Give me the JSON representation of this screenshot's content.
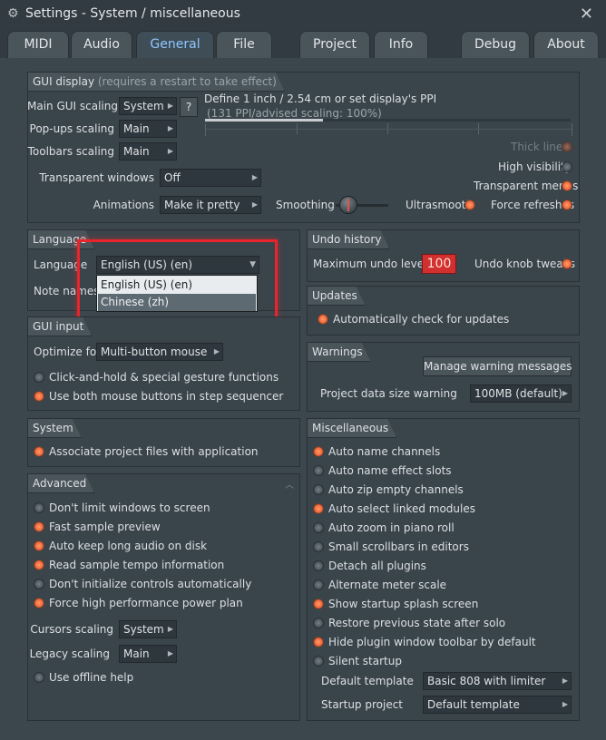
{
  "window": {
    "title": "Settings - System / miscellaneous",
    "close_icon": "close-icon"
  },
  "tabs": [
    "MIDI",
    "Audio",
    "General",
    "File",
    "Project",
    "Info",
    "Debug",
    "About"
  ],
  "gui_display": {
    "title": "GUI display",
    "title_note": "(requires a restart to take effect)",
    "main_gui_scaling_label": "Main GUI scaling",
    "main_gui_scaling_value": "System",
    "help_label": "?",
    "ppi_label": "Define 1 inch / 2.54 cm or set display's PPI",
    "ppi_value": "(131 PPI/advised scaling: 100%)",
    "popups_scaling_label": "Pop-ups scaling",
    "popups_scaling_value": "Main",
    "toolbars_scaling_label": "Toolbars scaling",
    "toolbars_scaling_value": "Main",
    "transparent_windows_label": "Transparent windows",
    "transparent_windows_value": "Off",
    "animations_label": "Animations",
    "animations_value": "Make it pretty",
    "smoothing_label": "Smoothing",
    "ultrasmooth_label": "Ultrasmooth",
    "thick_lines_label": "Thick lines",
    "high_visibility_label": "High visibility",
    "transparent_menus_label": "Transparent menus",
    "force_refreshes_label": "Force refreshes"
  },
  "language": {
    "title": "Language",
    "language_label": "Language",
    "language_value": "English (US) (en)",
    "note_names_label": "Note names",
    "options": [
      "English (US) (en)",
      "Chinese (zh)"
    ]
  },
  "undo_history": {
    "title": "Undo history",
    "max_undo_label": "Maximum undo levels",
    "max_undo_value": "100",
    "undo_knob_label": "Undo knob tweaks"
  },
  "updates": {
    "title": "Updates",
    "auto_check_label": "Automatically check for updates"
  },
  "gui_input": {
    "title": "GUI input",
    "optimize_label": "Optimize for",
    "optimize_value": "Multi-button mouse",
    "click_hold_label": "Click-and-hold & special gesture functions",
    "both_buttons_label": "Use both mouse buttons in step sequencer"
  },
  "warnings": {
    "title": "Warnings",
    "manage_label": "Manage warning messages",
    "size_warning_label": "Project data size warning",
    "size_warning_value": "100MB (default)"
  },
  "system": {
    "title": "System",
    "associate_label": "Associate project files with application"
  },
  "advanced": {
    "title": "Advanced",
    "items": [
      "Don't limit windows to screen",
      "Fast sample preview",
      "Auto keep long audio on disk",
      "Read sample tempo information",
      "Don't initialize controls automatically",
      "Force high performance power plan"
    ],
    "cursors_label": "Cursors scaling",
    "cursors_value": "System",
    "legacy_label": "Legacy scaling",
    "legacy_value": "Main",
    "offline_help_label": "Use offline help"
  },
  "miscellaneous": {
    "title": "Miscellaneous",
    "items": [
      "Auto name channels",
      "Auto name effect slots",
      "Auto zip empty channels",
      "Auto select linked modules",
      "Auto zoom in piano roll",
      "Small scrollbars in editors",
      "Detach all plugins",
      "Alternate meter scale",
      "Show startup splash screen",
      "Restore previous state after solo",
      "Hide plugin window toolbar by default",
      "Silent startup"
    ],
    "default_template_label": "Default template",
    "default_template_value": "Basic 808 with limiter",
    "startup_project_label": "Startup project",
    "startup_project_value": "Default template"
  },
  "colors": {
    "accent": "#8ec7ff",
    "radio_on": "#f36b3d",
    "highlight": "#e8252c"
  }
}
